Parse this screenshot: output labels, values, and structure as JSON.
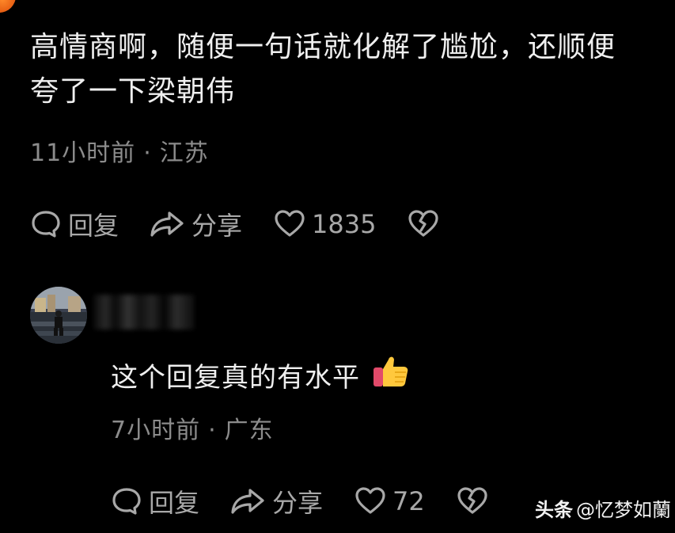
{
  "comment": {
    "text_line1": "高情商啊，随便一句话就化解了尴尬，还顺便",
    "text_line2": "夸了一下梁朝伟",
    "time": "11小时前",
    "dot": "·",
    "location": "江苏",
    "reply_label": "回复",
    "share_label": "分享",
    "like_count": "1835"
  },
  "reply": {
    "text": "这个回复真的有水平",
    "time": "7小时前",
    "dot": "·",
    "location": "广东",
    "reply_label": "回复",
    "share_label": "分享",
    "like_count": "72"
  },
  "watermark": {
    "brand": "头条",
    "handle": "@忆梦如蘭"
  },
  "colors": {
    "background": "#000000",
    "text": "#efefef",
    "meta": "#8c8c8c",
    "action": "#a8a8a8"
  }
}
